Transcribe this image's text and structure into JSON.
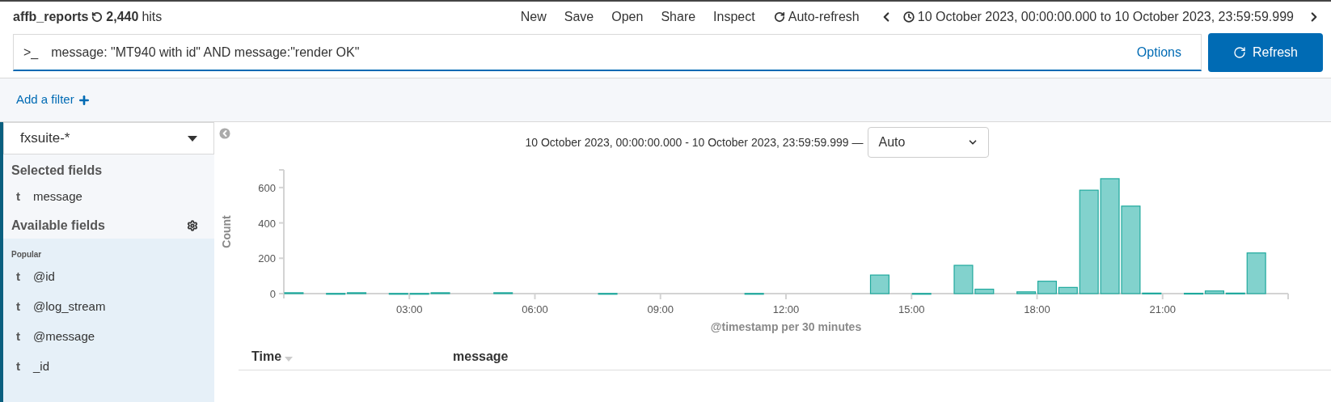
{
  "header": {
    "title": "affb_reports",
    "hits_count": "2,440",
    "hits_label": "hits",
    "menu": [
      "New",
      "Save",
      "Open",
      "Share",
      "Inspect"
    ],
    "auto_refresh": "Auto-refresh",
    "time_range": "10 October 2023, 00:00:00.000 to 10 October 2023, 23:59:59.999"
  },
  "query": {
    "prompt": ">_",
    "value": "message: \"MT940 with id\" AND message:\"render OK\"",
    "options": "Options",
    "refresh_button": "Refresh"
  },
  "filter_bar": {
    "add_filter": "Add a filter"
  },
  "sidebar": {
    "index_pattern": "fxsuite-*",
    "selected_heading": "Selected fields",
    "selected_fields": [
      {
        "type": "t",
        "name": "message"
      }
    ],
    "available_heading": "Available fields",
    "popular_label": "Popular",
    "available_fields": [
      {
        "type": "t",
        "name": "@id"
      },
      {
        "type": "t",
        "name": "@log_stream"
      },
      {
        "type": "t",
        "name": "@message"
      },
      {
        "type": "t",
        "name": "_id"
      }
    ]
  },
  "histogram": {
    "range_label": "10 October 2023, 00:00:00.000 - 10 October 2023, 23:59:59.999 —",
    "interval": "Auto",
    "chart_data": {
      "type": "bar",
      "xlabel": "@timestamp per 30 minutes",
      "ylabel": "Count",
      "x": [
        0.25,
        0.75,
        1.25,
        1.75,
        2.25,
        2.75,
        3.25,
        3.75,
        4.25,
        4.75,
        5.25,
        5.75,
        6.25,
        6.75,
        7.25,
        7.75,
        8.25,
        8.75,
        9.25,
        9.75,
        10.25,
        10.75,
        11.25,
        11.75,
        12.25,
        12.75,
        13.25,
        13.75,
        14.25,
        14.75,
        15.25,
        15.75,
        16.25,
        16.75,
        17.25,
        17.75,
        18.25,
        18.75,
        19.25,
        19.75,
        20.25,
        20.75,
        21.25,
        21.75,
        22.25,
        22.75,
        23.25,
        23.75
      ],
      "values": [
        5,
        0,
        1,
        5,
        0,
        1,
        1,
        5,
        0,
        0,
        5,
        0,
        0,
        0,
        0,
        1,
        0,
        0,
        0,
        0,
        0,
        0,
        1,
        0,
        0,
        0,
        0,
        0,
        105,
        0,
        1,
        0,
        160,
        25,
        0,
        10,
        70,
        35,
        585,
        650,
        495,
        3,
        0,
        2,
        15,
        3,
        230,
        0
      ],
      "xlim": [
        0,
        24
      ],
      "ylim": [
        0,
        700
      ],
      "xticks": [
        {
          "value": 3,
          "label": "03:00"
        },
        {
          "value": 6,
          "label": "06:00"
        },
        {
          "value": 9,
          "label": "09:00"
        },
        {
          "value": 12,
          "label": "12:00"
        },
        {
          "value": 15,
          "label": "15:00"
        },
        {
          "value": 18,
          "label": "18:00"
        },
        {
          "value": 21,
          "label": "21:00"
        }
      ],
      "yticks": [
        0,
        200,
        400,
        600
      ]
    }
  },
  "table": {
    "columns": [
      {
        "label": "Time",
        "sorted": true
      },
      {
        "label": "message",
        "sorted": false
      }
    ]
  }
}
